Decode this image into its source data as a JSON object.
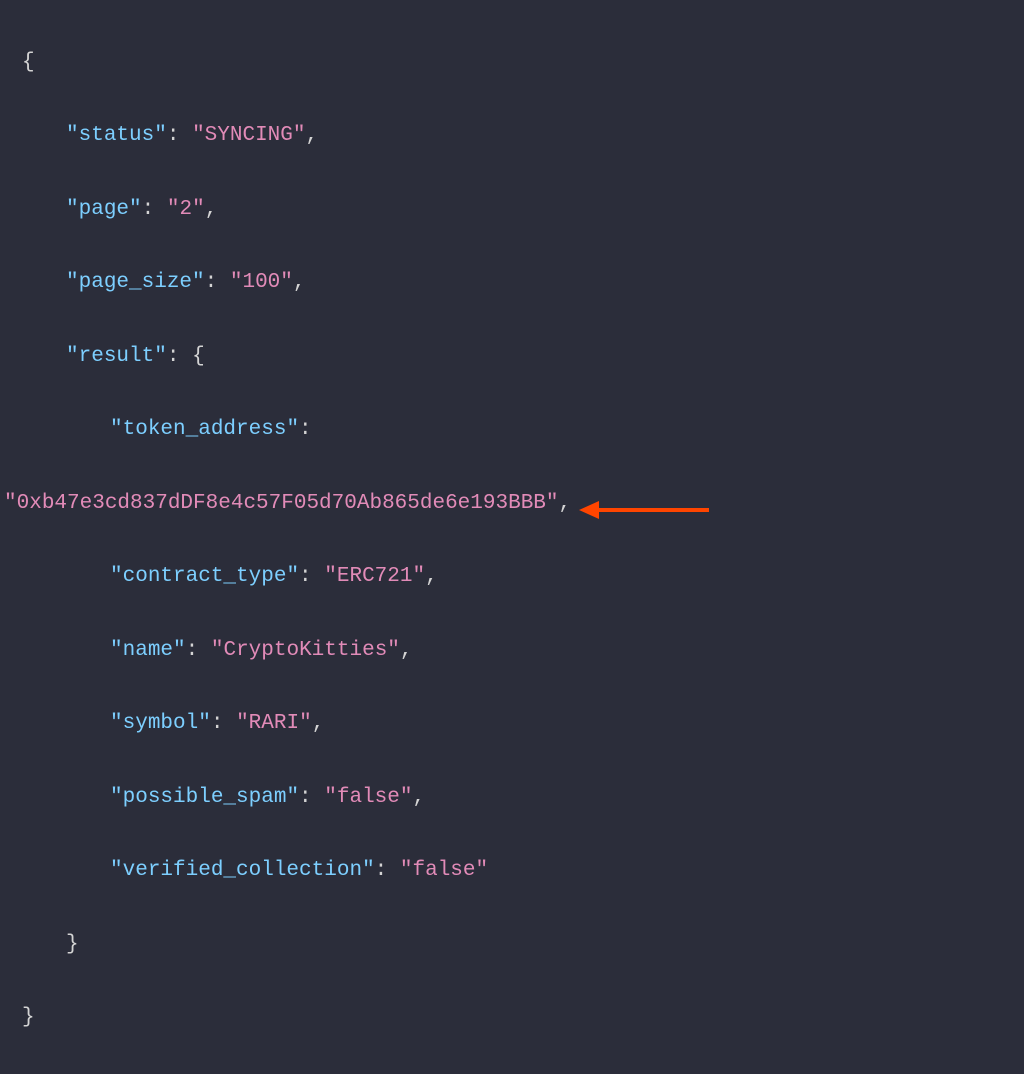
{
  "json": {
    "open_brace": "{",
    "close_brace": "}",
    "colon_space": ": ",
    "comma": ",",
    "q": "\"",
    "keys": {
      "status": "status",
      "page": "page",
      "page_size": "page_size",
      "result": "result",
      "token_address": "token_address",
      "contract_type": "contract_type",
      "name": "name",
      "symbol": "symbol",
      "possible_spam": "possible_spam",
      "verified_collection": "verified_collection"
    },
    "values": {
      "status": "SYNCING",
      "page": "2",
      "page_size": "100",
      "token_address": "0xb47e3cd837dDF8e4c57F05d70Ab865de6e193BBB",
      "contract_type": "ERC721",
      "name": "CryptoKitties",
      "symbol": "RARI",
      "possible_spam": "false",
      "verified_collection": "false"
    }
  },
  "annotation": {
    "arrow_target": "verified_collection",
    "arrow_color": "#ff4500"
  }
}
